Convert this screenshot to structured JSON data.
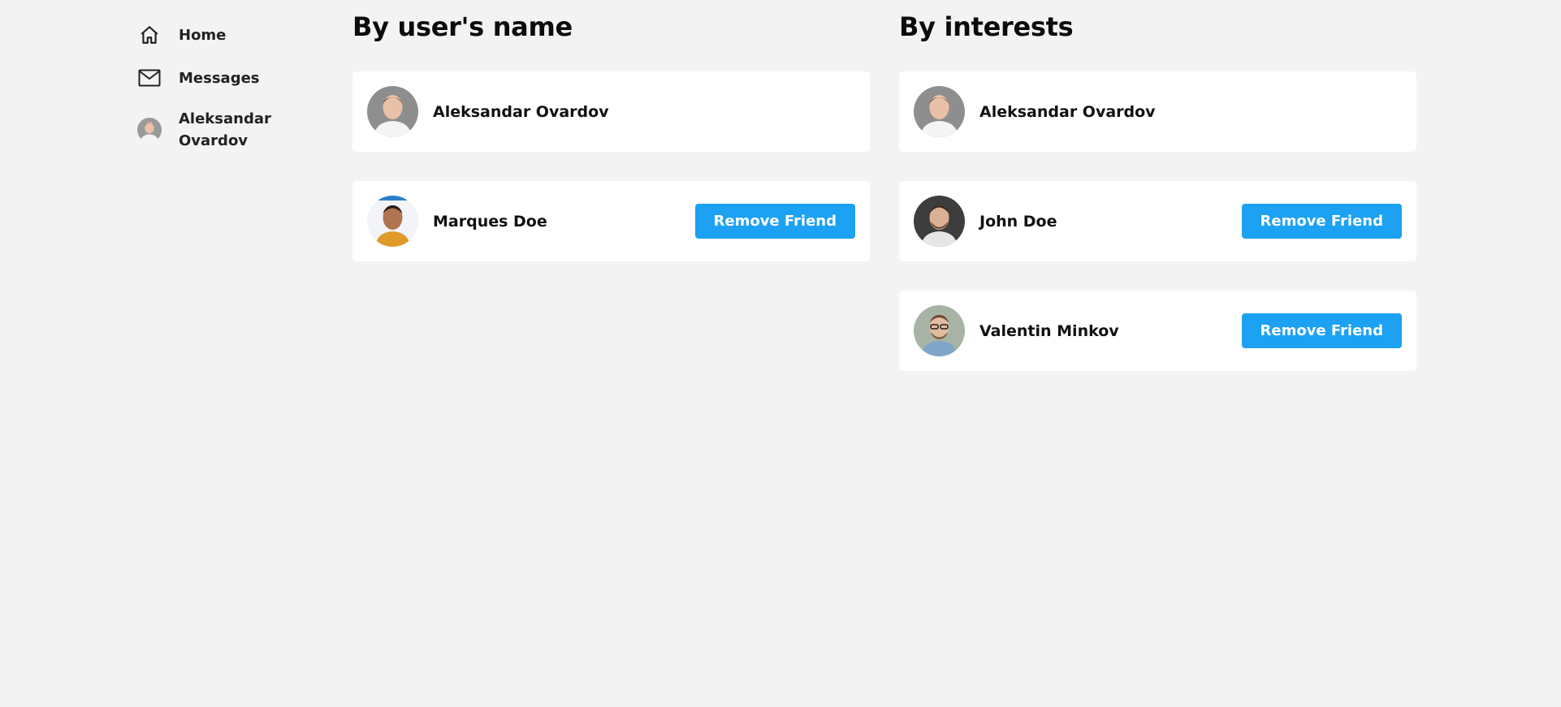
{
  "sidebar": {
    "items": [
      {
        "label": "Home",
        "icon": "home-icon"
      },
      {
        "label": "Messages",
        "icon": "envelope-icon"
      },
      {
        "label": "Aleksandar Ovardov",
        "icon": "avatar"
      }
    ]
  },
  "by_name": {
    "title": "By user's name",
    "results": [
      {
        "name": "Aleksandar Ovardov",
        "button": ""
      },
      {
        "name": "Marques Doe",
        "button": "Remove Friend"
      }
    ]
  },
  "by_interests": {
    "title": "By interests",
    "results": [
      {
        "name": "Aleksandar Ovardov",
        "button": ""
      },
      {
        "name": "John Doe",
        "button": "Remove Friend"
      },
      {
        "name": "Valentin Minkov",
        "button": "Remove Friend"
      }
    ]
  },
  "colors": {
    "background": "#f3f3f3",
    "card": "#ffffff",
    "button": "#1da1f2"
  }
}
